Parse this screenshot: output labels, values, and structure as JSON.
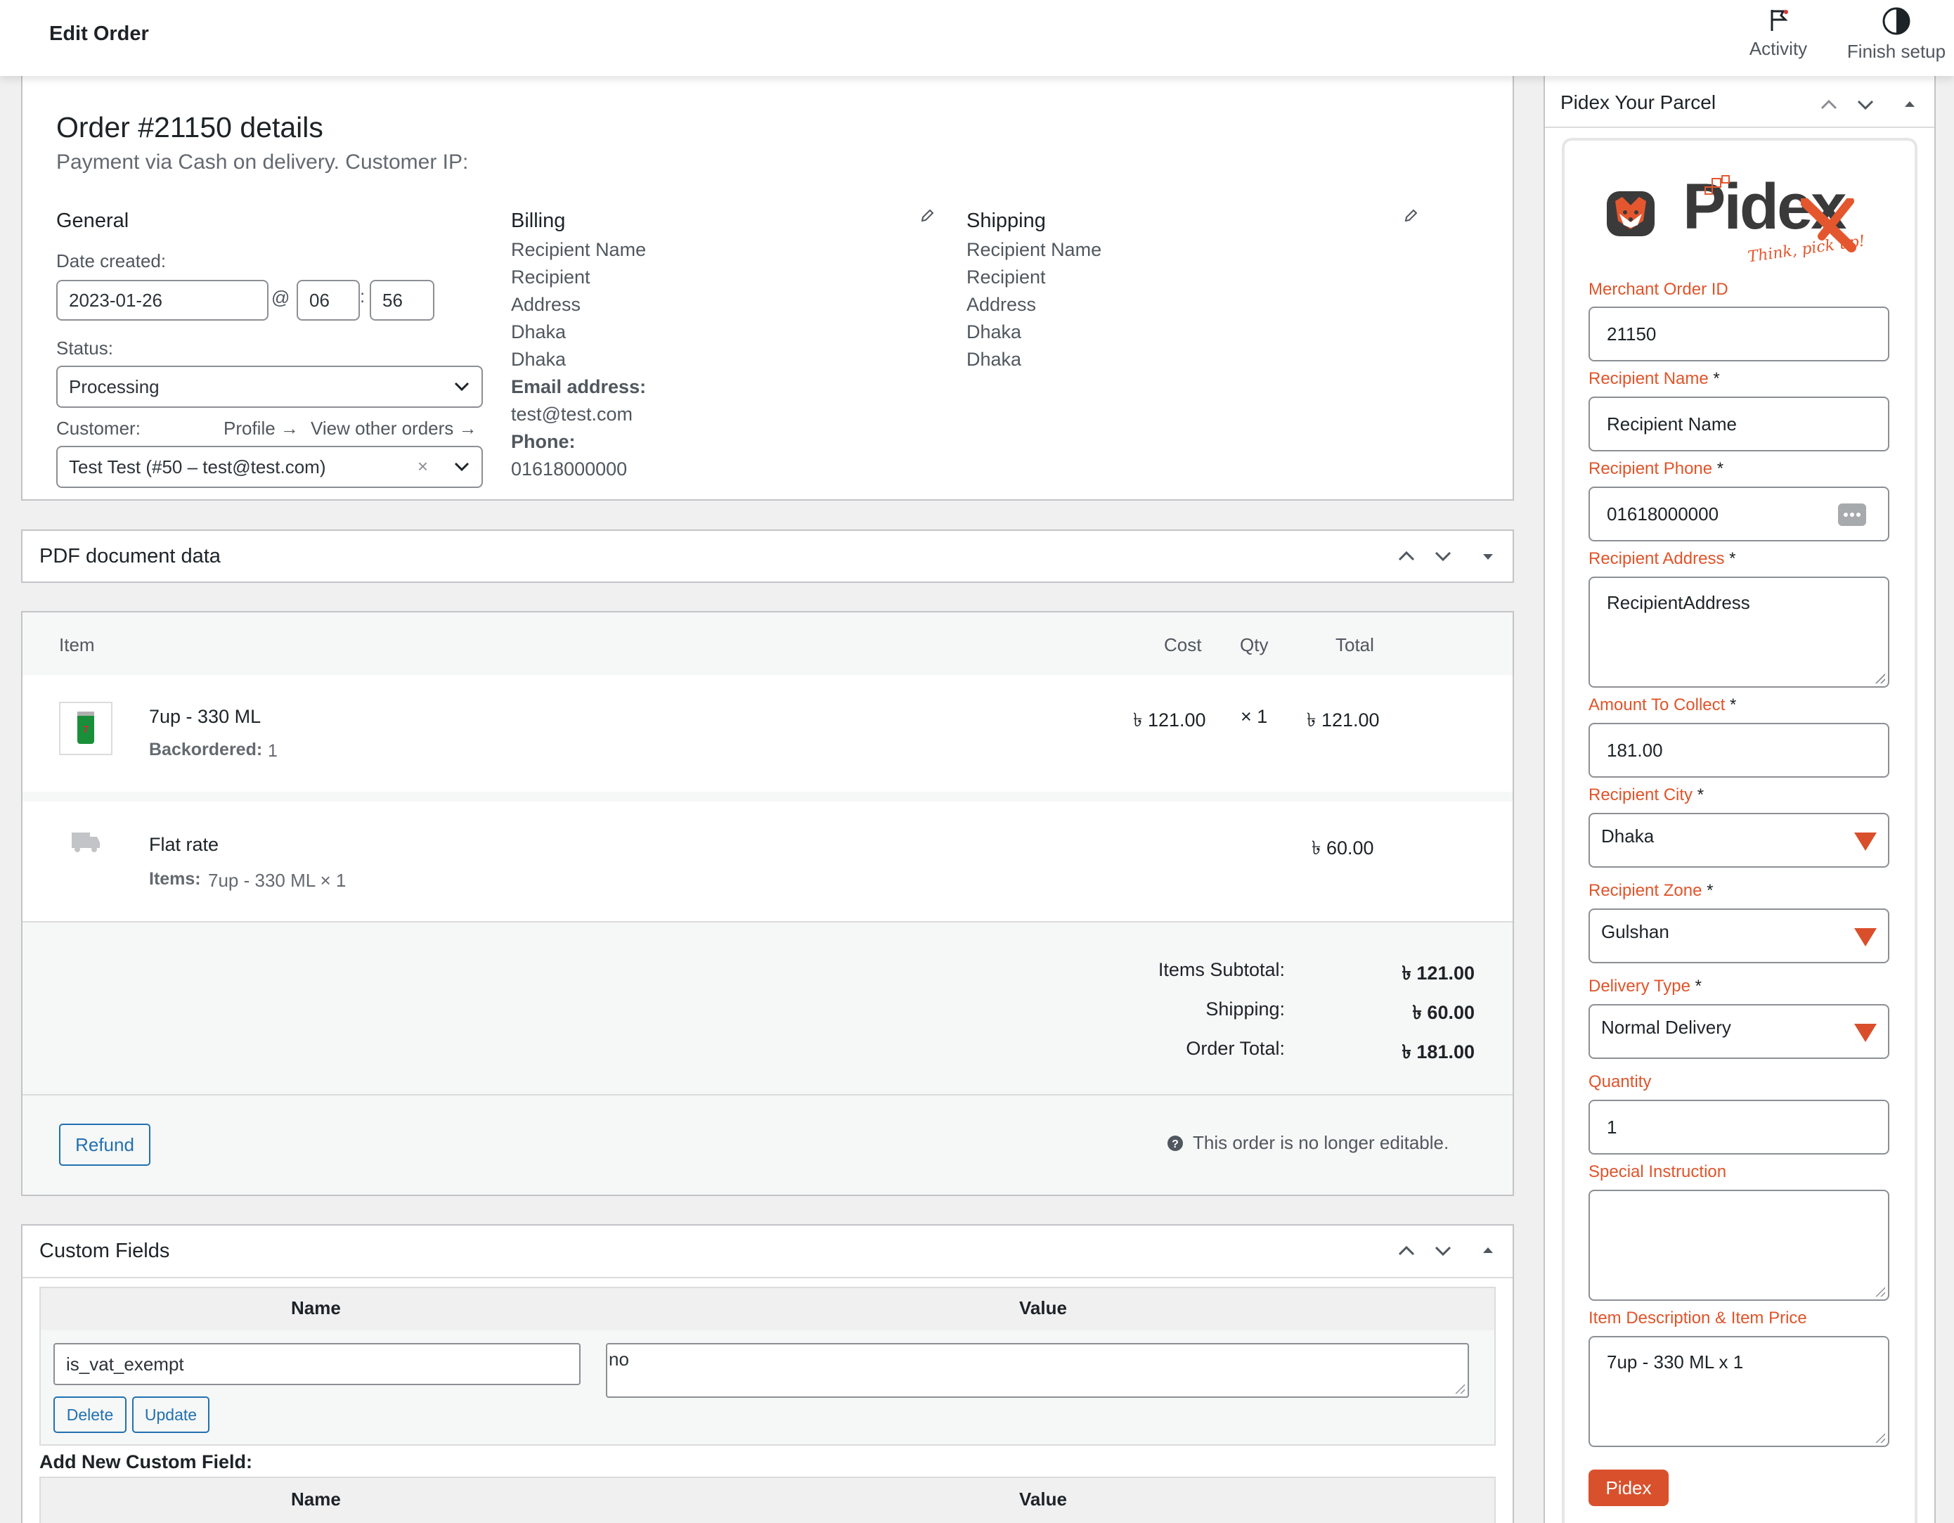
{
  "header": {
    "title": "Edit Order",
    "activity_label": "Activity",
    "finish_setup_label": "Finish setup"
  },
  "order": {
    "heading": "Order #21150 details",
    "subheading": "Payment via Cash on delivery. Customer IP:",
    "general": {
      "title": "General",
      "date_label": "Date created:",
      "date_value": "2023-01-26",
      "at": "@",
      "hour": "06",
      "minute": "56",
      "colon": ":",
      "status_label": "Status:",
      "status_value": "Processing",
      "customer_label": "Customer:",
      "profile_link": "Profile →",
      "view_orders_link": "View other orders →",
      "customer_value": "Test Test (#50 – test@test.com)",
      "clear": "×"
    },
    "billing": {
      "title": "Billing",
      "lines": [
        "Recipient Name",
        "Recipient",
        "Address",
        "Dhaka",
        "Dhaka"
      ],
      "email_label": "Email address:",
      "email": "test@test.com",
      "phone_label": "Phone:",
      "phone": "01618000000"
    },
    "shipping": {
      "title": "Shipping",
      "lines": [
        "Recipient Name",
        "Recipient",
        "Address",
        "Dhaka",
        "Dhaka"
      ]
    }
  },
  "pdf_panel": {
    "title": "PDF document data"
  },
  "items": {
    "headers": {
      "item": "Item",
      "cost": "Cost",
      "qty": "Qty",
      "total": "Total"
    },
    "line": {
      "name": "7up - 330 ML",
      "backordered_label": "Backordered:",
      "backordered_value": "1",
      "cost": "৳ 121.00",
      "qty": "× 1",
      "total": "৳ 121.00"
    },
    "shipping_line": {
      "name": "Flat rate",
      "items_label": "Items:",
      "items_value": "7up - 330 ML × 1",
      "total": "৳ 60.00"
    },
    "totals": {
      "subtotal_label": "Items Subtotal:",
      "subtotal": "৳ 121.00",
      "shipping_label": "Shipping:",
      "shipping": "৳ 60.00",
      "order_total_label": "Order Total:",
      "order_total": "৳ 181.00"
    },
    "refund_label": "Refund",
    "not_editable": "This order is no longer editable."
  },
  "custom_fields": {
    "title": "Custom Fields",
    "name_header": "Name",
    "value_header": "Value",
    "row": {
      "name": "is_vat_exempt",
      "value": "no"
    },
    "delete_label": "Delete",
    "update_label": "Update",
    "add_new_label": "Add New Custom Field:"
  },
  "pidex": {
    "panel_title": "Pidex Your Parcel",
    "logo_text": "Pidex",
    "tagline": "Think, pick up!",
    "fields": {
      "merchant_order_id": {
        "label": "Merchant Order ID",
        "value": "21150"
      },
      "recipient_name": {
        "label": "Recipient Name",
        "value": "Recipient Name"
      },
      "recipient_phone": {
        "label": "Recipient Phone",
        "value": "01618000000"
      },
      "recipient_address": {
        "label": "Recipient Address",
        "value": "RecipientAddress"
      },
      "amount_to_collect": {
        "label": "Amount To Collect",
        "value": "181.00"
      },
      "recipient_city": {
        "label": "Recipient City",
        "value": "Dhaka"
      },
      "recipient_zone": {
        "label": "Recipient Zone",
        "value": "Gulshan"
      },
      "delivery_type": {
        "label": "Delivery Type",
        "value": "Normal Delivery"
      },
      "quantity": {
        "label": "Quantity",
        "value": "1"
      },
      "special_instruction": {
        "label": "Special Instruction",
        "value": ""
      },
      "item_description": {
        "label": "Item Description & Item Price",
        "value": "7up - 330 ML x 1"
      }
    },
    "required_mark": "*",
    "submit_label": "Pidex"
  },
  "colors": {
    "accent_blue": "#2271b1",
    "pidex_orange": "#e0542a",
    "pidex_button": "#d9512c"
  }
}
